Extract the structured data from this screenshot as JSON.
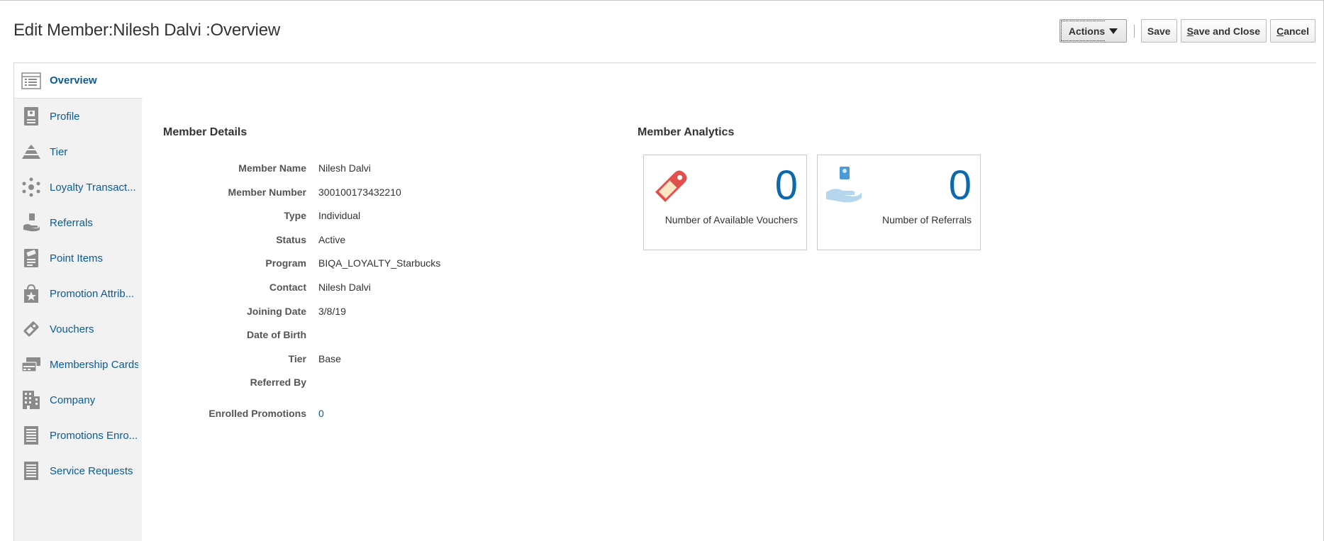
{
  "header": {
    "title": "Edit Member:Nilesh Dalvi :Overview",
    "actions_label": "Actions",
    "save_label": "Save",
    "save_close_label": "ave and Close",
    "save_close_accel": "S",
    "cancel_label": "ancel",
    "cancel_accel": "C"
  },
  "sidebar": {
    "items": [
      {
        "label": "Overview",
        "icon": "overview-list-icon"
      },
      {
        "label": "Profile",
        "icon": "profile-badge-icon"
      },
      {
        "label": "Tier",
        "icon": "tier-pyramid-icon"
      },
      {
        "label": "Loyalty Transact...",
        "icon": "transactions-icon"
      },
      {
        "label": "Referrals",
        "icon": "referral-hand-icon"
      },
      {
        "label": "Point Items",
        "icon": "point-items-icon"
      },
      {
        "label": "Promotion Attrib...",
        "icon": "promotion-bag-icon"
      },
      {
        "label": "Vouchers",
        "icon": "voucher-tag-icon"
      },
      {
        "label": "Membership Cards",
        "icon": "cards-icon"
      },
      {
        "label": "Company",
        "icon": "building-icon"
      },
      {
        "label": "Promotions Enro...",
        "icon": "document-lines-icon"
      },
      {
        "label": "Service Requests",
        "icon": "document-lines-icon"
      }
    ]
  },
  "details": {
    "title": "Member Details",
    "rows": [
      {
        "label": "Member Name",
        "value": "Nilesh Dalvi"
      },
      {
        "label": "Member Number",
        "value": "300100173432210"
      },
      {
        "label": "Type",
        "value": "Individual"
      },
      {
        "label": "Status",
        "value": "Active"
      },
      {
        "label": "Program",
        "value": "BIQA_LOYALTY_Starbucks"
      },
      {
        "label": "Contact",
        "value": "Nilesh Dalvi"
      },
      {
        "label": "Joining Date",
        "value": "3/8/19"
      },
      {
        "label": "Date of Birth",
        "value": ""
      },
      {
        "label": "Tier",
        "value": "Base"
      },
      {
        "label": "Referred By",
        "value": ""
      },
      {
        "label": "Enrolled Promotions",
        "value": "0"
      }
    ]
  },
  "analytics": {
    "title": "Member Analytics",
    "cards": [
      {
        "value": "0",
        "caption": "Number of Available Vouchers",
        "icon": "voucher-tag-icon"
      },
      {
        "value": "0",
        "caption": "Number of Referrals",
        "icon": "referral-hand-icon"
      }
    ]
  },
  "colors": {
    "link": "#0b5b94",
    "metric": "#0b6aad",
    "voucher_red": "#e0504d",
    "referral_blue": "#7fb4dc"
  }
}
